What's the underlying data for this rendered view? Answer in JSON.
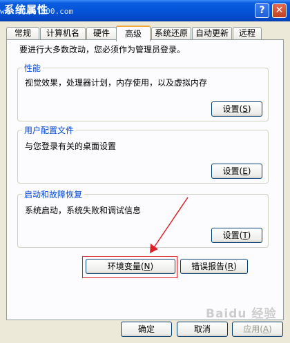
{
  "window": {
    "title": "系统属性",
    "watermark": "www.bluel000.com",
    "help_glyph": "?",
    "close_glyph": "✕"
  },
  "tabs": [
    "常规",
    "计算机名",
    "硬件",
    "高级",
    "系统还原",
    "自动更新",
    "远程"
  ],
  "active_tab": "高级",
  "intro_text": "要进行大多数改动，您必须作为管理员登录。",
  "groups": {
    "performance": {
      "title": "性能",
      "desc": "视觉效果，处理器计划，内存使用，以及虚拟内存",
      "button": "设置",
      "mnemonic": "S"
    },
    "profiles": {
      "title": "用户配置文件",
      "desc": "与您登录有关的桌面设置",
      "button": "设置",
      "mnemonic": "E"
    },
    "startup": {
      "title": "启动和故障恢复",
      "desc": "系统启动，系统失败和调试信息",
      "button": "设置",
      "mnemonic": "T"
    }
  },
  "env_button": {
    "label": "环境变量",
    "mnemonic": "N"
  },
  "error_button": {
    "label": "错误报告",
    "mnemonic": "R"
  },
  "footer": {
    "ok": "确定",
    "cancel": "取消",
    "apply": "应用",
    "apply_mnemonic": "A"
  },
  "overlay_watermark": "Baidu 经验",
  "annotation_color": "#d9222a"
}
